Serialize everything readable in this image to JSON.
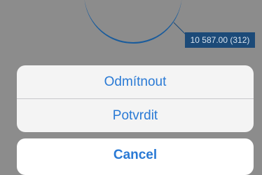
{
  "background": {
    "chart_value_label": "10 587.00 (312)",
    "pie_color": "#1a5c9c",
    "overlay_color": "#8c8c8c"
  },
  "action_sheet": {
    "actions": [
      {
        "label": "Odmítnout"
      },
      {
        "label": "Potvrdit"
      }
    ],
    "cancel_label": "Cancel",
    "accent_color": "#2a7ad5"
  }
}
